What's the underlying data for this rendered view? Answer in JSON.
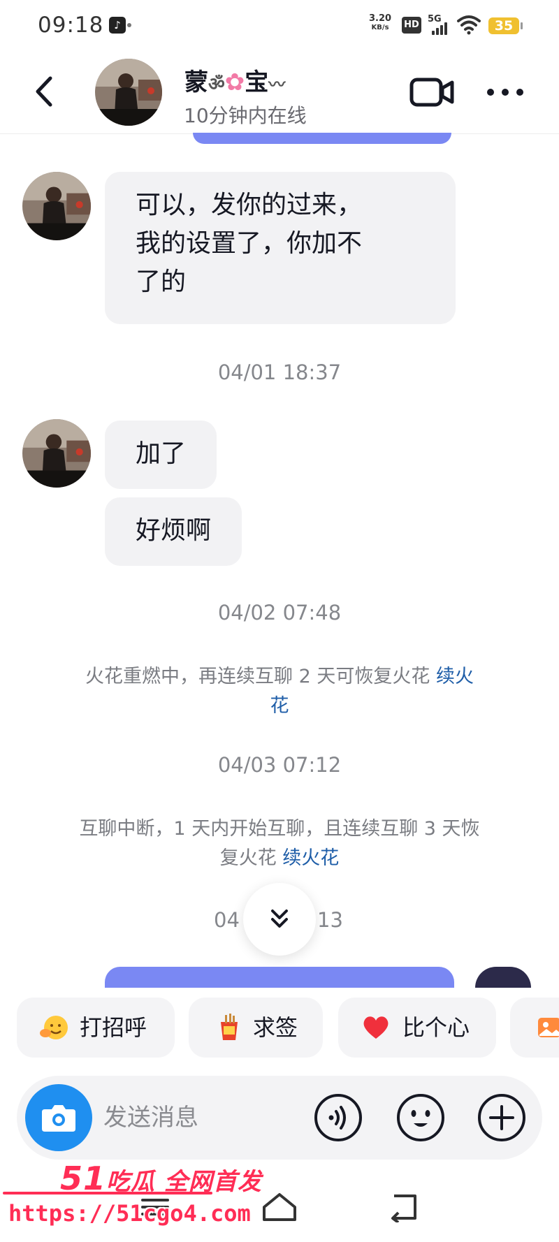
{
  "status_bar": {
    "time": "09:18",
    "speed_value": "3.20",
    "speed_unit": "KB/s",
    "hd": "HD",
    "network": "5G",
    "battery": "35"
  },
  "header": {
    "name_prefix": "蒙",
    "name_suffix": "宝",
    "status": "10分钟内在线"
  },
  "messages": [
    {
      "text": "可以，发你的过来，\n我的设置了，你加不\n了的"
    },
    {
      "timestamp": "04/01 18:37"
    },
    {
      "text": "加了"
    },
    {
      "text": "好烦啊"
    },
    {
      "timestamp": "04/02 07:48"
    },
    {
      "system": "火花重燃中，再连续互聊 2 天可恢复火花",
      "link": "续火花"
    },
    {
      "timestamp": "04/03 07:12"
    },
    {
      "system": "互聊中断，1 天内开始互聊，且连续互聊 3 天恢复火花",
      "link": "续火花"
    },
    {
      "timestamp_left": "04",
      "timestamp_right": "13"
    }
  ],
  "quick_replies": [
    {
      "label": "打招呼",
      "icon": "smile-hand-emoji-icon"
    },
    {
      "label": "求签",
      "icon": "fortune-box-icon"
    },
    {
      "label": "比个心",
      "icon": "red-heart-icon"
    },
    {
      "label": "",
      "icon": "photo-album-icon"
    }
  ],
  "input": {
    "placeholder": "发送消息"
  },
  "watermark": {
    "brand_number": "51",
    "brand_text": "吃瓜 全网首发",
    "url": "https://51cgo4.com"
  },
  "colors": {
    "accent_blue": "#1f8ff0",
    "sent_bubble": "#7a88f3",
    "link": "#1f5ea8",
    "watermark": "#ff2d55",
    "battery": "#f0c030"
  }
}
